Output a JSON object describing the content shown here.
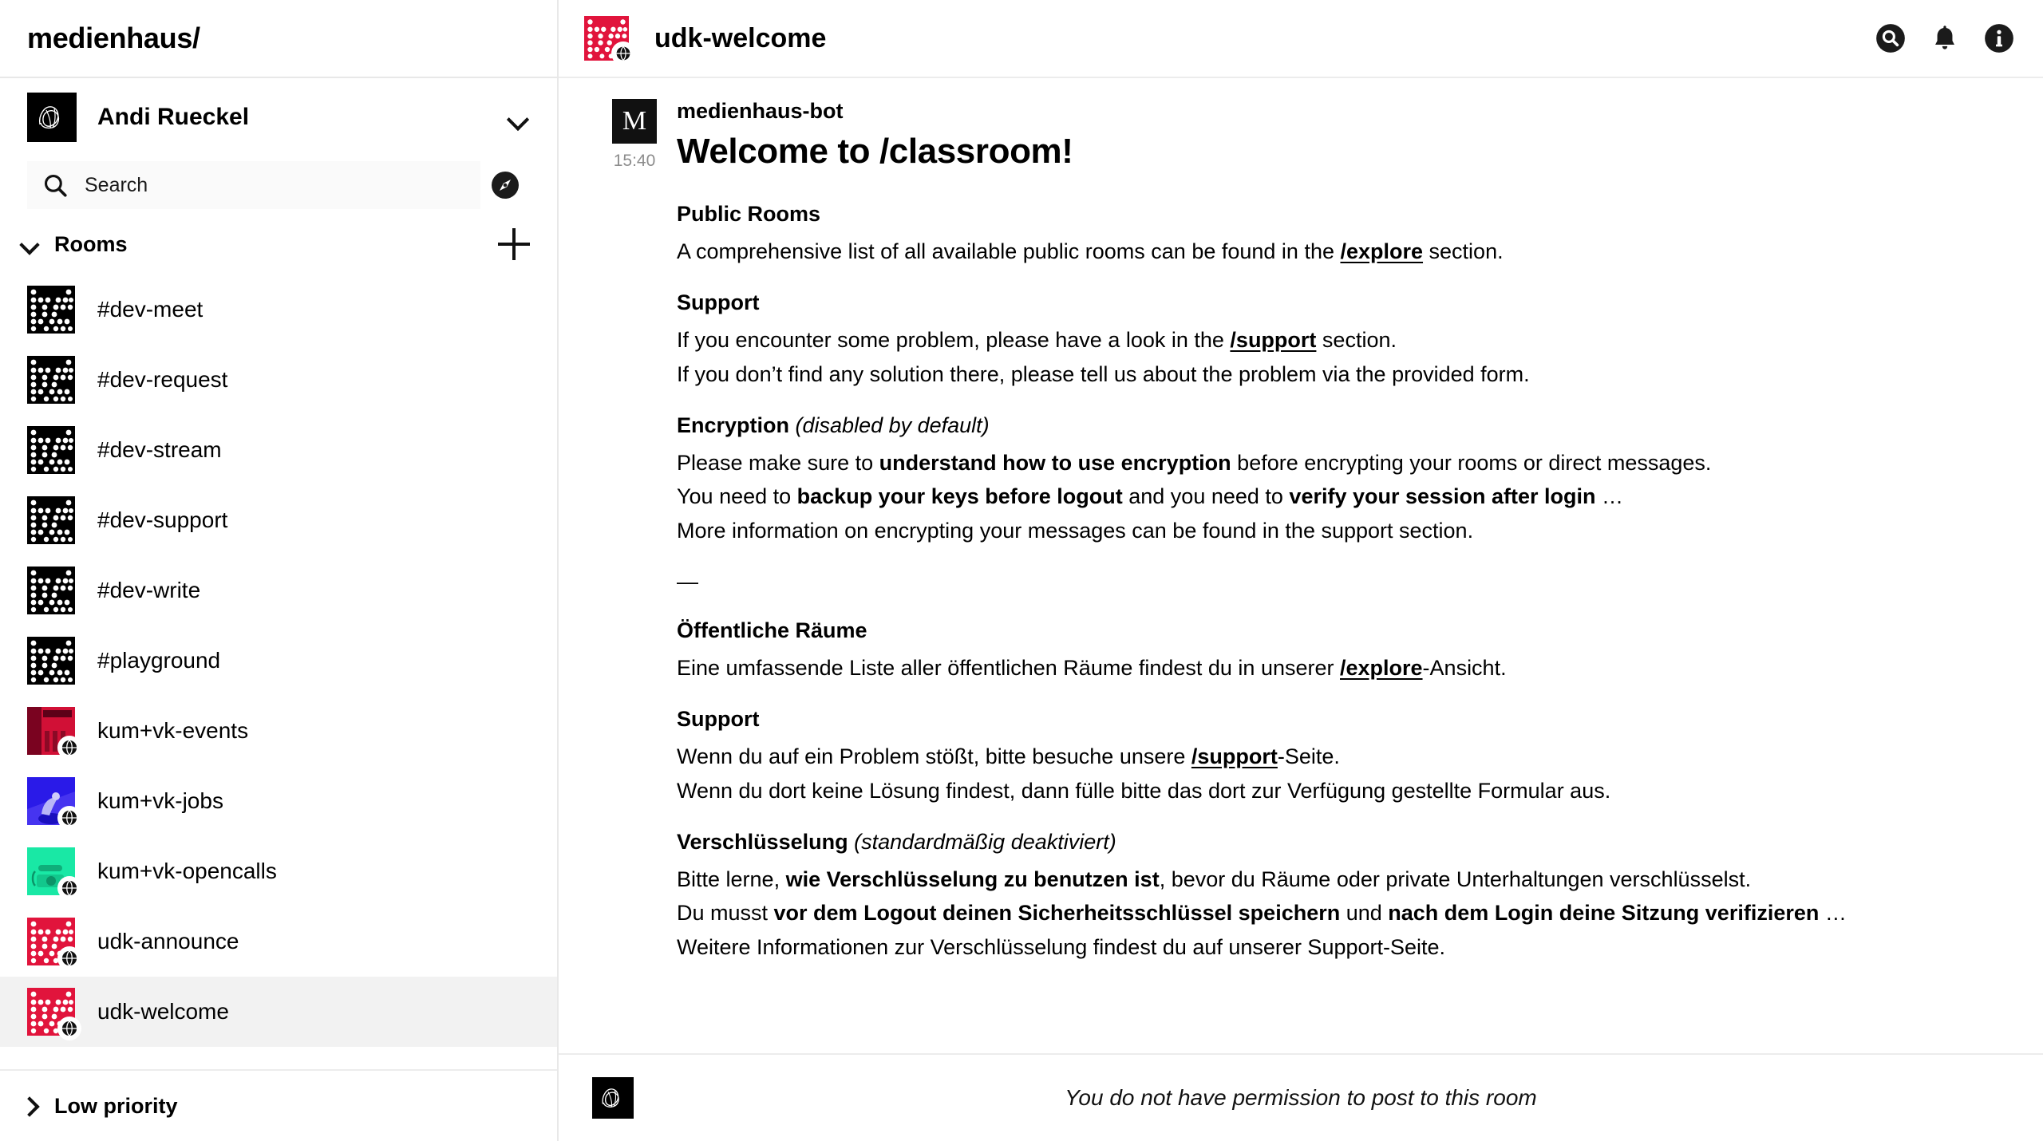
{
  "sidebar": {
    "brand_title": "medienhaus/",
    "account": {
      "name": "Andi Rueckel",
      "avatar_icon": "signature-avatar",
      "expand_icon": "chevron-down-icon"
    },
    "search": {
      "placeholder": "Search",
      "icon": "search-icon",
      "explore_icon": "compass-icon"
    },
    "rooms_section": {
      "label": "Rooms",
      "caret_icon": "chevron-down-icon",
      "add_icon": "plus-icon",
      "items": [
        {
          "name": "#dev-meet",
          "avatar_type": "dots",
          "avatar_color": "#000000",
          "public": false
        },
        {
          "name": "#dev-request",
          "avatar_type": "dots",
          "avatar_color": "#000000",
          "public": false
        },
        {
          "name": "#dev-stream",
          "avatar_type": "dots",
          "avatar_color": "#000000",
          "public": false
        },
        {
          "name": "#dev-support",
          "avatar_type": "dots",
          "avatar_color": "#000000",
          "public": false
        },
        {
          "name": "#dev-write",
          "avatar_type": "dots",
          "avatar_color": "#000000",
          "public": false
        },
        {
          "name": "#playground",
          "avatar_type": "dots",
          "avatar_color": "#000000",
          "public": false
        },
        {
          "name": "kum+vk-events",
          "avatar_type": "photo",
          "avatar_color": "#b4082c",
          "public": true
        },
        {
          "name": "kum+vk-jobs",
          "avatar_type": "photo",
          "avatar_color": "#2a1ae8",
          "public": true
        },
        {
          "name": "kum+vk-opencalls",
          "avatar_type": "photo",
          "avatar_color": "#19e8a5",
          "public": true
        },
        {
          "name": "udk-announce",
          "avatar_type": "dots",
          "avatar_color": "#e1143c",
          "public": true
        },
        {
          "name": "udk-welcome",
          "avatar_type": "dots",
          "avatar_color": "#e1143c",
          "public": true,
          "active": true
        }
      ]
    },
    "low_priority": {
      "label": "Low priority",
      "caret_icon": "chevron-right-icon"
    }
  },
  "header": {
    "room_title": "udk-welcome",
    "room_avatar_color": "#e1143c",
    "actions": [
      {
        "icon": "search-icon",
        "name": "search-button"
      },
      {
        "icon": "bell-icon",
        "name": "notifications-button"
      },
      {
        "icon": "info-icon",
        "name": "room-info-button"
      }
    ]
  },
  "message": {
    "sender": "medienhaus-bot",
    "sender_initial": "M",
    "time": "15:40",
    "title": "Welcome to /classroom!",
    "divider": "—",
    "sections": [
      {
        "heading": "Public Rooms",
        "note": "",
        "lines": [
          [
            {
              "t": "A comprehensive list of all available public rooms can be found in the ",
              "s": "n"
            },
            {
              "t": "/explore",
              "s": "l"
            },
            {
              "t": " section.",
              "s": "n"
            }
          ]
        ]
      },
      {
        "heading": "Support",
        "note": "",
        "lines": [
          [
            {
              "t": "If you encounter some problem, please have a look in the ",
              "s": "n"
            },
            {
              "t": "/support",
              "s": "l"
            },
            {
              "t": " section.",
              "s": "n"
            }
          ],
          [
            {
              "t": "If you don’t find any solution there, please tell us about the problem via the provided form.",
              "s": "n"
            }
          ]
        ]
      },
      {
        "heading": "Encryption",
        "note": "(disabled by default)",
        "lines": [
          [
            {
              "t": "Please make sure to ",
              "s": "n"
            },
            {
              "t": "understand how to use encryption",
              "s": "b"
            },
            {
              "t": " before encrypting your rooms or direct messages.",
              "s": "n"
            }
          ],
          [
            {
              "t": "You need to ",
              "s": "n"
            },
            {
              "t": "backup your keys before logout",
              "s": "b"
            },
            {
              "t": " and you need to ",
              "s": "n"
            },
            {
              "t": "verify your session after login",
              "s": "b"
            },
            {
              "t": " …",
              "s": "n"
            }
          ],
          [
            {
              "t": "More information on encrypting your messages can be found in the support section.",
              "s": "n"
            }
          ]
        ]
      },
      {
        "heading": "Öffentliche Räume",
        "note": "",
        "after_divider": true,
        "lines": [
          [
            {
              "t": "Eine umfassende Liste aller öffentlichen Räume findest du in unserer ",
              "s": "n"
            },
            {
              "t": "/explore",
              "s": "l"
            },
            {
              "t": "-Ansicht.",
              "s": "n"
            }
          ]
        ]
      },
      {
        "heading": "Support",
        "note": "",
        "lines": [
          [
            {
              "t": "Wenn du auf ein Problem stößt, bitte besuche unsere ",
              "s": "n"
            },
            {
              "t": "/support",
              "s": "l"
            },
            {
              "t": "-Seite.",
              "s": "n"
            }
          ],
          [
            {
              "t": "Wenn du dort keine Lösung findest, dann fülle bitte das dort zur Verfügung gestellte Formular aus.",
              "s": "n"
            }
          ]
        ]
      },
      {
        "heading": "Verschlüsselung",
        "note": "(standardmäßig deaktiviert)",
        "lines": [
          [
            {
              "t": "Bitte lerne, ",
              "s": "n"
            },
            {
              "t": "wie Verschlüsselung zu benutzen ist",
              "s": "b"
            },
            {
              "t": ", bevor du Räume oder private Unterhaltungen verschlüsselst.",
              "s": "n"
            }
          ],
          [
            {
              "t": "Du musst ",
              "s": "n"
            },
            {
              "t": "vor dem Logout deinen Sicherheitsschlüssel speichern",
              "s": "b"
            },
            {
              "t": " und ",
              "s": "n"
            },
            {
              "t": "nach dem Login deine Sitzung verifizieren",
              "s": "b"
            },
            {
              "t": " …",
              "s": "n"
            }
          ],
          [
            {
              "t": "Weitere Informationen zur Verschlüsselung findest du auf unserer Support-Seite.",
              "s": "n"
            }
          ]
        ]
      }
    ]
  },
  "composer": {
    "avatar_icon": "signature-avatar",
    "note": "You do not have permission to post to this room"
  },
  "colors": {
    "accent_red": "#e1143c",
    "text": "#000000",
    "muted": "#8c8c8c",
    "border": "#ececec",
    "active_row": "#f2f2f2"
  }
}
